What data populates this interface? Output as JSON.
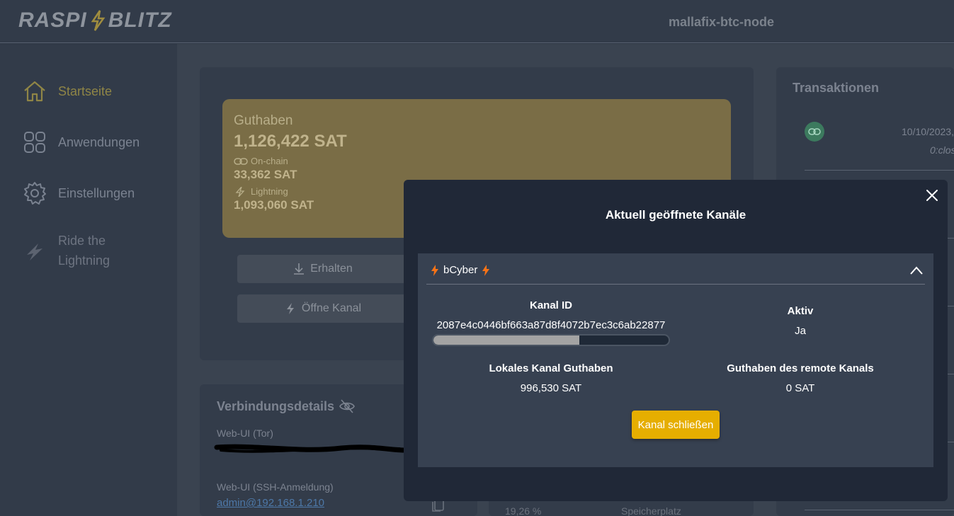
{
  "header": {
    "logo_left": "RASPI",
    "logo_right": "BLITZ",
    "node_name": "mallafix-btc-node"
  },
  "sidebar": {
    "items": [
      {
        "label": "Startseite",
        "icon": "home-icon",
        "active": true
      },
      {
        "label": "Anwendungen",
        "icon": "apps-grid-icon"
      },
      {
        "label": "Einstellungen",
        "icon": "gear-icon"
      },
      {
        "label_line1": "Ride the",
        "label_line2": "Lightning",
        "icon": "rtl-bolt-icon"
      }
    ]
  },
  "wallet": {
    "title": "Guthaben",
    "total": "1,126,422 SAT",
    "onchain_label": "On-chain",
    "onchain_value": "33,362 SAT",
    "lightning_label": "Lightning",
    "lightning_value": "1,093,060 SAT",
    "receive_label": "Erhalten",
    "open_channel_label": "Öffne Kanal"
  },
  "connection": {
    "title": "Verbindungsdetails",
    "tor_label": "Web-UI (Tor)",
    "ssh_label": "Web-UI (SSH-Anmeldung)",
    "ssh_link": "admin@192.168.1.210"
  },
  "background_fragments": {
    "disk_percent": "19,26 %",
    "storage_label": "Speicherplatz"
  },
  "transactions": {
    "title": "Transaktionen",
    "first_date": "10/10/2023,",
    "first_sub": "0:clos"
  },
  "modal": {
    "title": "Aktuell geöffnete Kanäle",
    "channel": {
      "peer_name": "bCyber",
      "id_label": "Kanal ID",
      "id_value": "2087e4c0446bf663a87d8f4072b7ec3c6ab22877",
      "active_label": "Aktiv",
      "active_value": "Ja",
      "local_label": "Lokales Kanal Guthaben",
      "local_value": "996,530 SAT",
      "remote_label": "Guthaben des remote Kanals",
      "remote_value": "0 SAT",
      "local_ratio": 0.62
    },
    "close_button_label": "Kanal schließen"
  },
  "colors": {
    "accent": "#e6ae00",
    "bolt": "#f97316",
    "balance_card": "#7a6d46"
  }
}
